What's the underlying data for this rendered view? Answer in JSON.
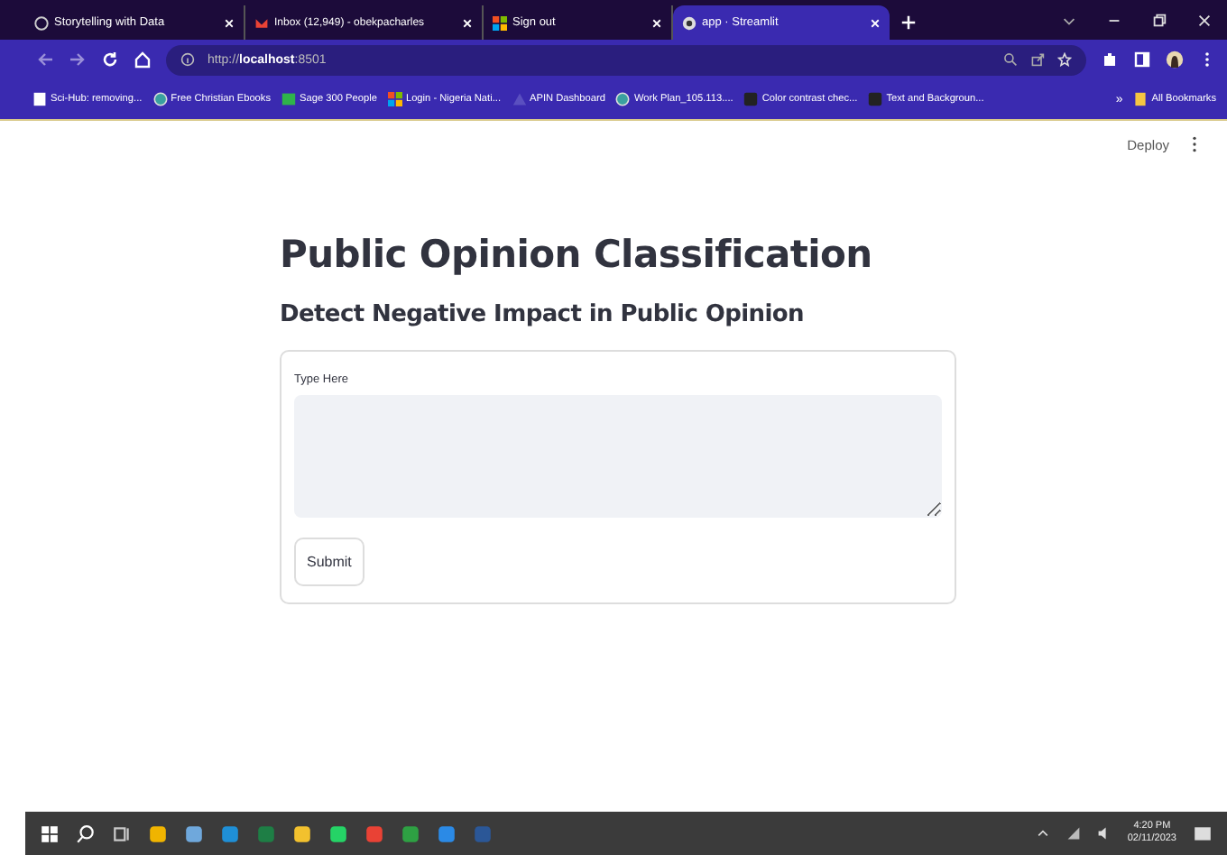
{
  "browser": {
    "tabs": [
      {
        "title": "Storytelling with Data",
        "selected": false
      },
      {
        "title": "Inbox (12,949) - obekpacharles",
        "selected": false
      },
      {
        "title": "Sign out",
        "selected": false
      },
      {
        "title": "app · Streamlit",
        "selected": true
      }
    ],
    "address": "http://**localhost**:8501",
    "bookmarks": [
      {
        "label": "Sci-Hub: removing..."
      },
      {
        "label": "Free Christian Ebooks"
      },
      {
        "label": "Sage 300 People"
      },
      {
        "label": "Login - Nigeria Nati..."
      },
      {
        "label": "APIN Dashboard"
      },
      {
        "label": "Work Plan_105.113...."
      },
      {
        "label": "Color contrast chec..."
      },
      {
        "label": "Text and Backgroun..."
      }
    ],
    "more": "»",
    "all_bookmarks": "All Bookmarks"
  },
  "app": {
    "deploy": "Deploy",
    "title": "Public Opinion Classification",
    "subtitle": "Detect Negative Impact in Public Opinion",
    "form": {
      "label": "Type Here",
      "submit": "Submit"
    }
  },
  "taskbar": {
    "time": "4:20 PM",
    "date": "02/11/2023"
  }
}
